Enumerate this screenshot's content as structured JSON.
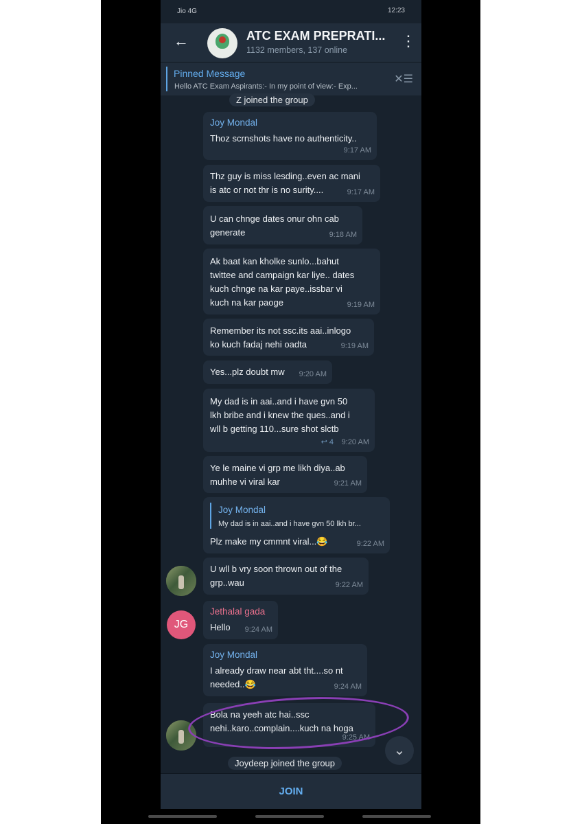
{
  "status": {
    "left": "Jio 4G  .ıl ≋ ⏰",
    "right": "🔕 ▭ ⚡ 12:23",
    "carrier": "Jio 4G",
    "time": "12:23"
  },
  "header": {
    "title": "ATC EXAM PREPRATI...",
    "subtitle": "1132 members, 137 online"
  },
  "pinned": {
    "title": "Pinned Message",
    "text": "Hello ATC Exam Aspirants:-  In my point of view:- Exp..."
  },
  "service_top": "Z joined the group",
  "messages": [
    {
      "name": "Joy Mondal",
      "lines": [
        "Thoz scrnshots have no authenticity.."
      ],
      "time": "9:17 AM"
    },
    {
      "lines": [
        "Thz guy is miss lesding..even ac mani",
        "is atc or not thr is no surity...."
      ],
      "time": "9:17 AM"
    },
    {
      "lines": [
        "U can chnge dates  onur ohn cab",
        "generate"
      ],
      "time": "9:18 AM"
    },
    {
      "lines": [
        "Ak baat kan kholke sunlo...bahut",
        "twittee and campaign kar liye..  dates",
        "kuch chnge na kar paye..issbar vi",
        "kuch na kar paoge"
      ],
      "time": "9:19 AM"
    },
    {
      "lines": [
        "Remember its not ssc.its aai..inlogo",
        "ko kuch fadaj nehi oadta"
      ],
      "time": "9:19 AM"
    },
    {
      "lines": [
        "Yes...plz doubt mw"
      ],
      "time": "9:20 AM"
    },
    {
      "lines": [
        "My dad is in aai..and i have gvn 50",
        "lkh bribe and i knew the ques..and i",
        "wll b getting 110...sure shot slctb"
      ],
      "time": "9:20 AM",
      "replies": "↩ 4"
    },
    {
      "lines": [
        "Ye le maine vi grp me likh diya..ab",
        "muhhe vi viral kar"
      ],
      "time": "9:21 AM"
    },
    {
      "reply_name": "Joy Mondal",
      "reply_text": "My dad is in aai..and i have gvn 50 lkh br...",
      "lines": [
        "Plz make my cmmnt viral...😂"
      ],
      "time": "9:22 AM"
    },
    {
      "lines": [
        "U wll b vry soon thrown out of the",
        "grp..wau"
      ],
      "time": "9:22 AM"
    },
    {
      "name": "Jethalal gada",
      "lines": [
        "Hello"
      ],
      "time": "9:24 AM",
      "initials": "JG"
    },
    {
      "name": "Joy Mondal",
      "lines": [
        "I already draw near abt tht....so nt",
        "needed..😂"
      ],
      "time": "9:24 AM"
    },
    {
      "lines": [
        "Bola na yeeh atc hai..ssc",
        "nehi..karo..complain....kuch na hoga"
      ],
      "time": "9:25 AM"
    }
  ],
  "service_bottom": "Joydeep joined the group",
  "join_label": "JOIN",
  "colors": {
    "accent": "#64aef0",
    "bubble": "#212d3b",
    "background": "#18222d",
    "highlight_circle": "#8a3fb5"
  }
}
